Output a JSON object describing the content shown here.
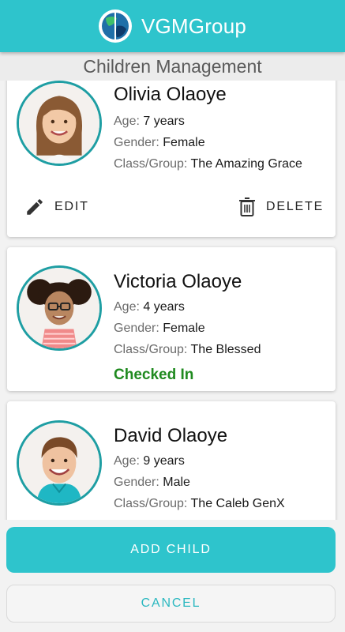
{
  "app": {
    "title": "VGMGroup",
    "logo_icon": "globe-logo-icon",
    "accent_color": "#2ec4cc"
  },
  "page": {
    "title": "Children Management"
  },
  "labels": {
    "age": "Age:",
    "gender": "Gender:",
    "class_group": "Class/Group:"
  },
  "children": [
    {
      "name": "Olivia Olaoye",
      "age": "7 years",
      "gender": "Female",
      "class_group": "The Amazing Grace",
      "edit_label": "EDIT",
      "delete_label": "DELETE"
    },
    {
      "name": "Victoria Olaoye",
      "age": "4 years",
      "gender": "Female",
      "class_group": "The Blessed",
      "status": "Checked In",
      "status_color": "#1f8a1f"
    },
    {
      "name": "David Olaoye",
      "age": "9 years",
      "gender": "Male",
      "class_group": "The Caleb GenX"
    }
  ],
  "buttons": {
    "add_child": "ADD CHILD",
    "cancel": "CANCEL"
  }
}
